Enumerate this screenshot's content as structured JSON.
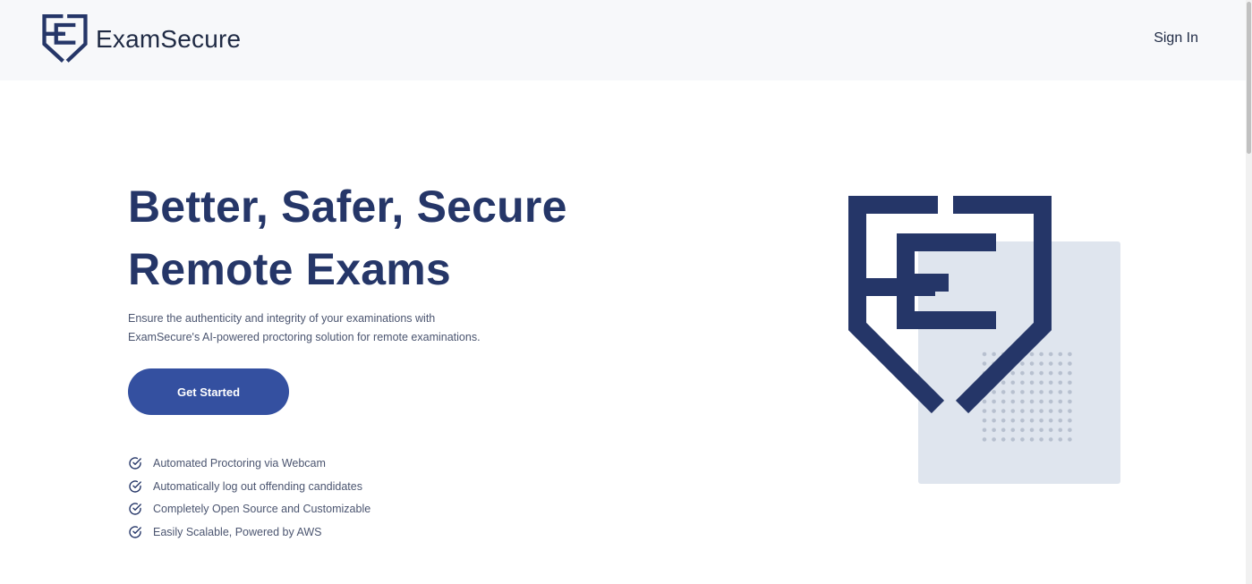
{
  "header": {
    "brand_name": "ExamSecure",
    "signin_label": "Sign In"
  },
  "hero": {
    "title_line1": "Better, Safer, Secure",
    "title_line2": "Remote Exams",
    "description_line1": "Ensure the authenticity and integrity of your examinations with",
    "description_line2": "ExamSecure's AI-powered proctoring solution for remote examinations.",
    "cta_label": "Get Started"
  },
  "features": [
    {
      "label": "Automated Proctoring via Webcam",
      "icon": "check-circle-icon"
    },
    {
      "label": "Automatically log out offending candidates",
      "icon": "check-circle-icon"
    },
    {
      "label": "Completely Open Source and Customizable",
      "icon": "check-circle-icon"
    },
    {
      "label": "Easily Scalable, Powered by AWS",
      "icon": "check-circle-icon"
    }
  ],
  "colors": {
    "brand_navy": "#253668",
    "button_blue": "#3450a0",
    "header_bg": "#f7f8fa",
    "card_bg": "#dfe5ee"
  }
}
